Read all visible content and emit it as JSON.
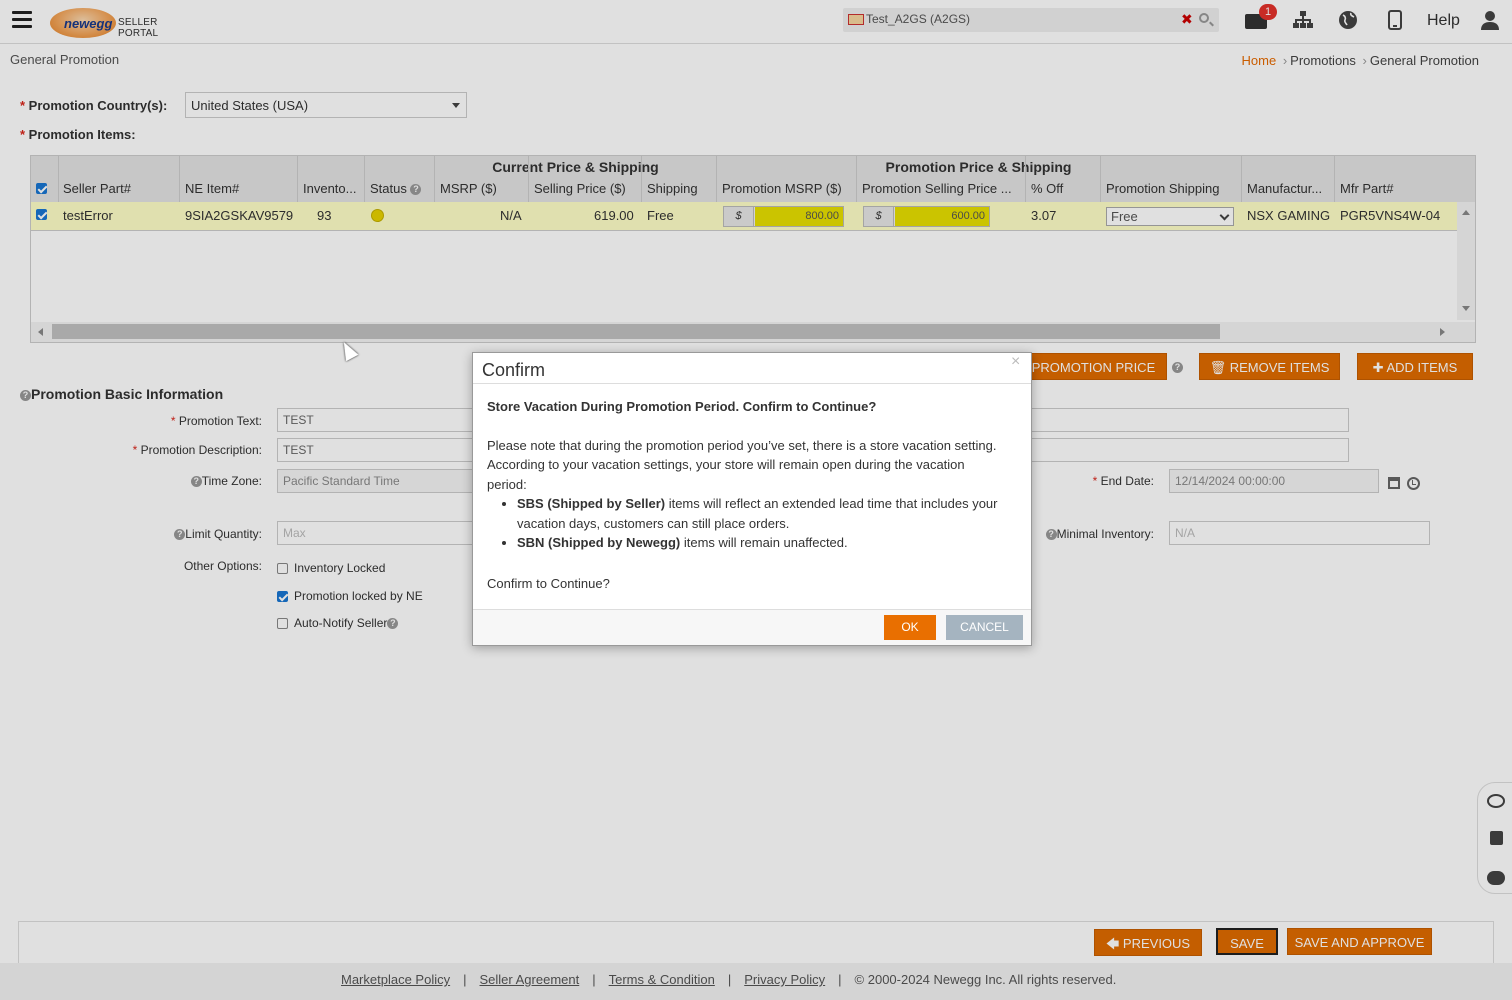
{
  "header": {
    "brand": "newegg",
    "portal_label": "SELLER PORTAL",
    "search_value": "Test_A2GS (A2GS)",
    "mail_badge": "1",
    "help_label": "Help"
  },
  "page": {
    "title": "General Promotion",
    "breadcrumb": [
      "Home",
      "Promotions",
      "General Promotion"
    ]
  },
  "form": {
    "country_label": "Promotion Country(s):",
    "country_value": "United States (USA)",
    "items_label": "Promotion Items:"
  },
  "grid": {
    "group_headers": [
      "Current Price & Shipping",
      "Promotion Price & Shipping"
    ],
    "columns": [
      "Seller Part#",
      "NE Item#",
      "Invento...",
      "Status",
      "MSRP ($)",
      "Selling Price ($)",
      "Shipping",
      "Promotion MSRP ($)",
      "Promotion Selling Price ...",
      "% Off",
      "Promotion Shipping",
      "Manufactur...",
      "Mfr Part#"
    ],
    "row": {
      "seller_part": "testError",
      "ne_item": "9SIA2GSKAV9579",
      "inventory": "93",
      "msrp": "N/A",
      "selling_price": "619.00",
      "shipping": "Free",
      "currency": "$",
      "promo_msrp": "800.00",
      "promo_selling": "600.00",
      "pct_off": "3.07",
      "promo_shipping": "Free",
      "manufacturer": "NSX GAMING",
      "mfr_part": "PGR5VNS4W-04"
    }
  },
  "actions": {
    "promo_price": "PROMOTION PRICE",
    "remove_items": "REMOVE ITEMS",
    "add_items": "ADD ITEMS"
  },
  "basic": {
    "title": "Promotion Basic Information",
    "promo_text_label": "Promotion Text:",
    "promo_text_value": "TEST",
    "promo_desc_label": "Promotion Description:",
    "promo_desc_value": "TEST",
    "timezone_label": "Time Zone:",
    "timezone_value": "Pacific Standard Time",
    "end_date_label": "End Date:",
    "end_date_value": "12/14/2024 00:00:00",
    "limit_qty_label": "Limit Quantity:",
    "limit_qty_placeholder": "Max",
    "min_inv_label": "Minimal Inventory:",
    "min_inv_placeholder": "N/A",
    "other_label": "Other Options:",
    "opt_inventory_locked": "Inventory Locked",
    "opt_locked_by_ne": "Promotion locked by NE",
    "opt_auto_notify": "Auto-Notify Seller"
  },
  "modal": {
    "title": "Confirm",
    "close": "×",
    "heading": "Store Vacation During Promotion Period. Confirm to Continue?",
    "intro": "Please note that during the promotion period you’ve set, there is a store vacation setting. According to your vacation settings, your store will remain open during the vacation period:",
    "b1_bold": "SBS (Shipped by Seller)",
    "b1_text": " items will reflect an extended lead time that includes your vacation days, customers can still place orders.",
    "b2_bold": "SBN (Shipped by Newegg)",
    "b2_text": " items will remain unaffected.",
    "question": "Confirm to Continue?",
    "ok": "OK",
    "cancel": "CANCEL"
  },
  "bottom": {
    "previous": "PREVIOUS",
    "save": "SAVE",
    "save_approve": "SAVE AND APPROVE"
  },
  "footer": {
    "links": [
      "Marketplace Policy",
      "Seller Agreement",
      "Terms & Condition",
      "Privacy Policy"
    ],
    "copyright": "© 2000-2024 Newegg Inc. All rights reserved."
  },
  "colors": {
    "accent": "#e06b00",
    "row_highlight": "#ffffc8",
    "promo_input": "#e8e000"
  }
}
